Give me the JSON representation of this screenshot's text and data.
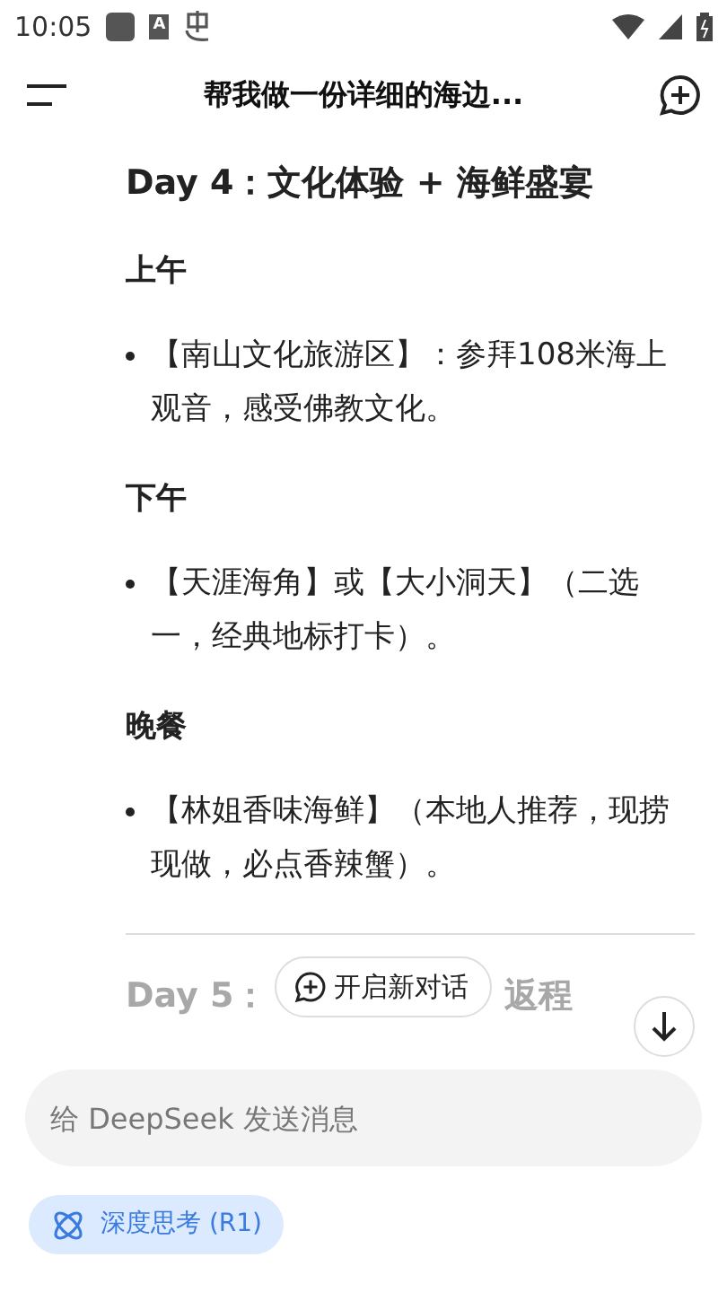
{
  "status_bar": {
    "time": "10:05",
    "notification_letter": "A"
  },
  "header": {
    "title": "帮我做一份详细的海边..."
  },
  "content": [
    {
      "kind": "heading",
      "text": "Day 4：文化体验 + 海鲜盛宴"
    },
    {
      "kind": "subheading",
      "text": "上午"
    },
    {
      "kind": "bullet",
      "text": "【南山文化旅游区】：参拜108米海上观音，感受佛教文化。"
    },
    {
      "kind": "subheading",
      "text": "下午"
    },
    {
      "kind": "bullet",
      "text": "【天涯海角】或【大小洞天】（二选一，经典地标打卡）。"
    },
    {
      "kind": "subheading",
      "text": "晚餐"
    },
    {
      "kind": "bullet",
      "text": "【林姐香味海鲜】（本地人推荐，现捞现做，必点香辣蟹）。"
    },
    {
      "kind": "divider"
    }
  ],
  "faded_heading": {
    "start": "Day 5：",
    "end": "返程"
  },
  "new_chat_button": {
    "label": "开启新对话"
  },
  "composer": {
    "placeholder": "给 DeepSeek 发送消息"
  },
  "deep_think": {
    "label": "深度思考 (R1)",
    "selected": true
  }
}
